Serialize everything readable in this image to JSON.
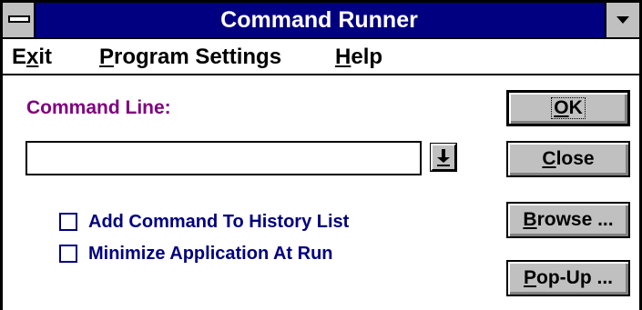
{
  "window": {
    "title": "Command Runner"
  },
  "menu": {
    "items": [
      {
        "pre": "E",
        "ul": "x",
        "post": "it"
      },
      {
        "pre": "",
        "ul": "P",
        "post": "rogram Settings"
      },
      {
        "pre": "",
        "ul": "H",
        "post": "elp"
      }
    ]
  },
  "form": {
    "command_label": "Command Line:",
    "command_value": "",
    "checkboxes": [
      {
        "label": "Add Command To History List",
        "checked": false
      },
      {
        "label": "Minimize Application At Run",
        "checked": false
      }
    ]
  },
  "buttons": {
    "ok": {
      "pre": "",
      "ul": "O",
      "post": "K"
    },
    "close": {
      "pre": "",
      "ul": "C",
      "post": "lose"
    },
    "browse": {
      "pre": "",
      "ul": "B",
      "post": "rowse ..."
    },
    "popup": {
      "pre": "",
      "ul": "P",
      "post": "op-Up ..."
    }
  },
  "colors": {
    "titlebar": "#000080",
    "label_purple": "#800080",
    "checkbox_navy": "#000080",
    "button_face": "#c0c0c0"
  },
  "icons": {
    "system_menu": "system-menu-icon",
    "minimize": "minimize-arrow-icon",
    "dropdown": "dropdown-arrow-icon"
  }
}
